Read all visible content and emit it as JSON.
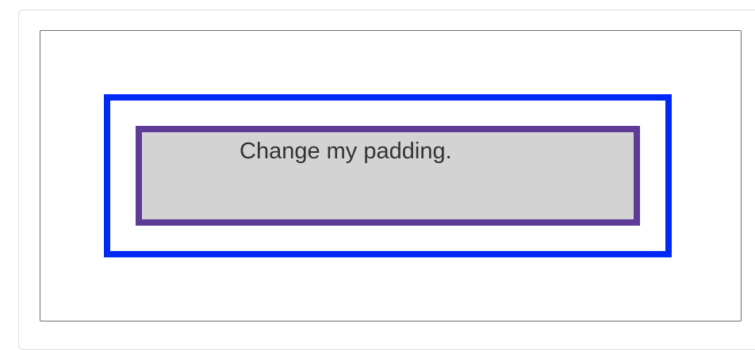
{
  "demo": {
    "text": "Change my padding."
  },
  "colors": {
    "outer_border": "#0029f5",
    "inner_border": "#5f3b98",
    "inner_background": "#d3d3d3",
    "text": "#333333",
    "frame_border": "#6f6f6f"
  }
}
